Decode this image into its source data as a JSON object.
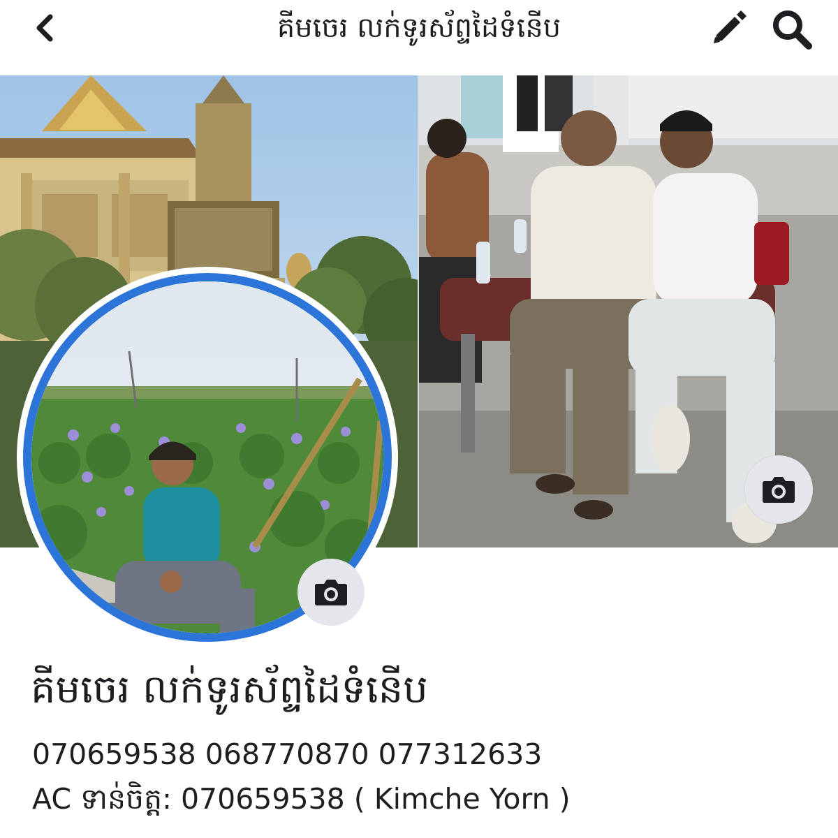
{
  "header": {
    "title": "គីមចេរ លក់ទូរស័ព្ទដៃទំនើប",
    "back_icon": "chevron-left-icon",
    "edit_icon": "pencil-icon",
    "search_icon": "search-icon"
  },
  "cover": {
    "camera_icon": "camera-icon"
  },
  "avatar": {
    "camera_icon": "camera-icon",
    "ring_color": "#2d74d8"
  },
  "profile": {
    "name": "គីមចេរ លក់ទូរស័ព្ទដៃទំនើប",
    "bio_line_1": "070659538 068770870 077312633",
    "bio_line_2": "AC ទាន់ចិត្ត: 070659538 ( Kimche Yorn )"
  },
  "colors": {
    "accent": "#2d74d8",
    "icon": "#1c1e21",
    "camera_bg": "#e4e6eb"
  }
}
